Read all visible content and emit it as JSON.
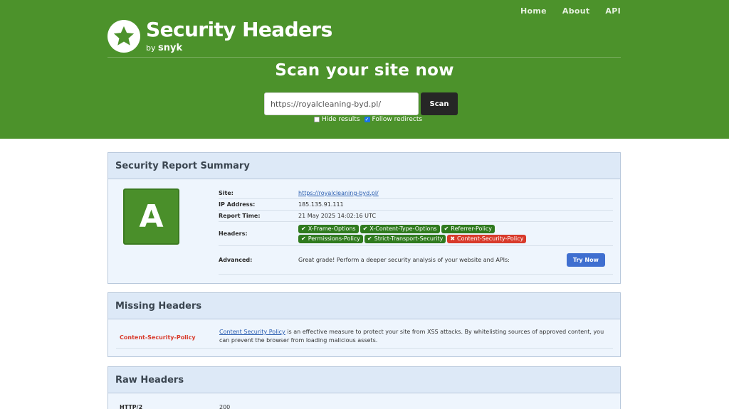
{
  "nav": {
    "items": [
      "Home",
      "About",
      "API"
    ]
  },
  "brand": {
    "title": "Security Headers",
    "by": "by",
    "company": "snyk"
  },
  "scan": {
    "title": "Scan your site now",
    "input_value": "https://royalcleaning-byd.pl/",
    "button_label": "Scan",
    "hide_results_label": "Hide results",
    "hide_results_checked": false,
    "follow_redirects_label": "Follow redirects",
    "follow_redirects_checked": true
  },
  "summary": {
    "title": "Security Report Summary",
    "grade": "A",
    "grade_color": "#4a8f2a",
    "site_label": "Site:",
    "site_value": "https://royalcleaning-byd.pl/",
    "ip_label": "IP Address:",
    "ip_value": "185.135.91.111",
    "time_label": "Report Time:",
    "time_value": "21 May 2025 14:02:16 UTC",
    "headers_label": "Headers:",
    "headers": [
      {
        "name": "X-Frame-Options",
        "status": "present"
      },
      {
        "name": "X-Content-Type-Options",
        "status": "present"
      },
      {
        "name": "Referrer-Policy",
        "status": "present"
      },
      {
        "name": "Permissions-Policy",
        "status": "present"
      },
      {
        "name": "Strict-Transport-Security",
        "status": "present"
      },
      {
        "name": "Content-Security-Policy",
        "status": "missing"
      }
    ],
    "advanced_label": "Advanced:",
    "advanced_text": "Great grade! Perform a deeper security analysis of your website and APIs:",
    "try_label": "Try Now"
  },
  "missing": {
    "title": "Missing Headers",
    "items": [
      {
        "name": "Content-Security-Policy",
        "link_text": "Content Security Policy",
        "desc": " is an effective measure to protect your site from XSS attacks. By whitelisting sources of approved content, you can prevent the browser from loading malicious assets."
      }
    ]
  },
  "raw": {
    "title": "Raw Headers",
    "rows": [
      {
        "key": "HTTP/2",
        "value": "200"
      }
    ]
  },
  "colors": {
    "brand_green": "#4c922b",
    "present": "#2f7a1e",
    "missing": "#d83a2b",
    "try_button": "#3f6fd0"
  }
}
